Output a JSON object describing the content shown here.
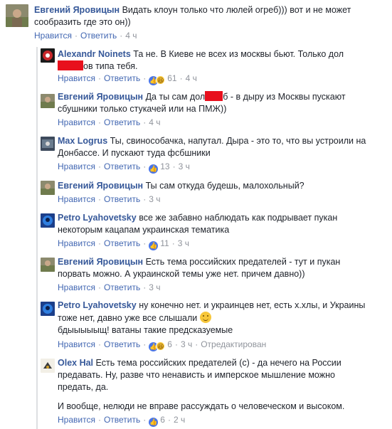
{
  "actions": {
    "like": "Нравится",
    "reply": "Ответить",
    "edited": "Отредактирован",
    "sep": "·"
  },
  "comments": [
    {
      "author": "Евгений Яровицын",
      "text": "Видать клоун только что люлей огреб))) вот и не может сообразить где это он))",
      "time": "4 ч"
    },
    {
      "author": "Alexandr Noinets",
      "text_a": "Та не. В Киеве не всех из москвы бьют. Только дол",
      "text_b": "ов типа тебя.",
      "reactions": "61",
      "time": "4 ч"
    },
    {
      "author": "Евгений Яровицын",
      "text_a": "Да ты сам дол",
      "text_b": "б - в дыру из Москвы пускают сбушники только стукачей или на ПМЖ))",
      "time": "4 ч"
    },
    {
      "author": "Max Logrus",
      "text": "Ты, свинособачка, напутал. Дыра - это то, что вы устроили на Донбассе. И пускают туда фсбшники",
      "reactions": "13",
      "time": "3 ч"
    },
    {
      "author": "Евгений Яровицын",
      "text": "Ты сам откуда будешь, малохольный?",
      "time": "3 ч"
    },
    {
      "author": "Petro Lyahovetsky",
      "text": "все же забавно наблюдать как подрывает пукан некоторым кацапам украинская тематика",
      "reactions": "11",
      "time": "3 ч"
    },
    {
      "author": "Евгений Яровицын",
      "text": "Есть тема российских предателей - тут и пукан порвать можно. А украинской темы уже нет. причем давно))",
      "time": "3 ч"
    },
    {
      "author": "Petro Lyahovetsky",
      "text": "ну конечно нет. и украинцев нет, есть х.хлы, и Украины тоже нет, давно уже все слышали",
      "text2": "бдыыыыыщ! ватаны такие предсказуемые",
      "reactions": "6",
      "time": "3 ч"
    },
    {
      "author": "Olex Hal",
      "text": "Есть тема российских предателей (с) - да нечего на России предавать. Ну, разве что ненависть и имперское мышление можно предать, да.",
      "text2": "И вообще, нелюди не вправе рассуждать о человеческом и высоком.",
      "reactions": "6",
      "time": "2 ч"
    }
  ],
  "colors": {
    "link": "#365899",
    "action": "#4267b2",
    "meta": "#90949c",
    "redaction": "#e8101d"
  }
}
